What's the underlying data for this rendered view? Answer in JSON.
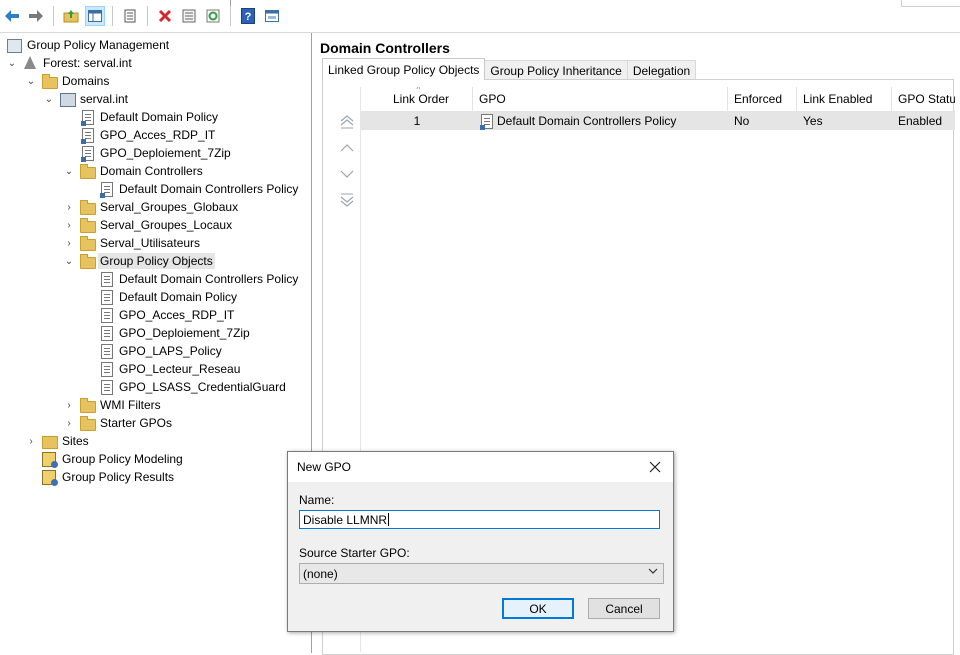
{
  "toolbar": {
    "buttons": [
      "back-icon",
      "forward-icon",
      "up-folder-icon",
      "show-hide-tree-icon",
      "properties-icon",
      "delete-icon",
      "export-list-icon",
      "refresh-icon",
      "help-icon",
      "console-icon"
    ]
  },
  "tree": {
    "root": "Group Policy Management",
    "forest": "Forest: serval.int",
    "domains": "Domains",
    "domain": "serval.int",
    "domain_children": [
      "Default Domain Policy",
      "GPO_Acces_RDP_IT",
      "GPO_Deploiement_7Zip",
      "Domain Controllers",
      "Default Domain Controllers Policy",
      "Serval_Groupes_Globaux",
      "Serval_Groupes_Locaux",
      "Serval_Utilisateurs",
      "Group Policy Objects",
      "Default Domain Controllers Policy",
      "Default Domain Policy",
      "GPO_Acces_RDP_IT",
      "GPO_Deploiement_7Zip",
      "GPO_LAPS_Policy",
      "GPO_Lecteur_Reseau",
      "GPO_LSASS_CredentialGuard",
      "WMI Filters",
      "Starter GPOs"
    ],
    "sites": "Sites",
    "modeling": "Group Policy Modeling",
    "results": "Group Policy Results"
  },
  "right_pane": {
    "title": "Domain Controllers",
    "tabs": [
      "Linked Group Policy Objects",
      "Group Policy Inheritance",
      "Delegation"
    ],
    "columns": [
      "Link Order",
      "GPO",
      "Enforced",
      "Link Enabled",
      "GPO Statu"
    ],
    "rows": [
      {
        "link_order": "1",
        "gpo": "Default Domain Controllers Policy",
        "enforced": "No",
        "link_enabled": "Yes",
        "status": "Enabled"
      }
    ]
  },
  "dialog": {
    "title": "New GPO",
    "name_label": "Name:",
    "name_value": "Disable LLMNR",
    "starter_label": "Source Starter GPO:",
    "starter_value": "(none)",
    "ok": "OK",
    "cancel": "Cancel"
  },
  "colors": {
    "selection": "#e5e5e5",
    "accent": "#0078d7",
    "folder": "#e7c35f"
  }
}
